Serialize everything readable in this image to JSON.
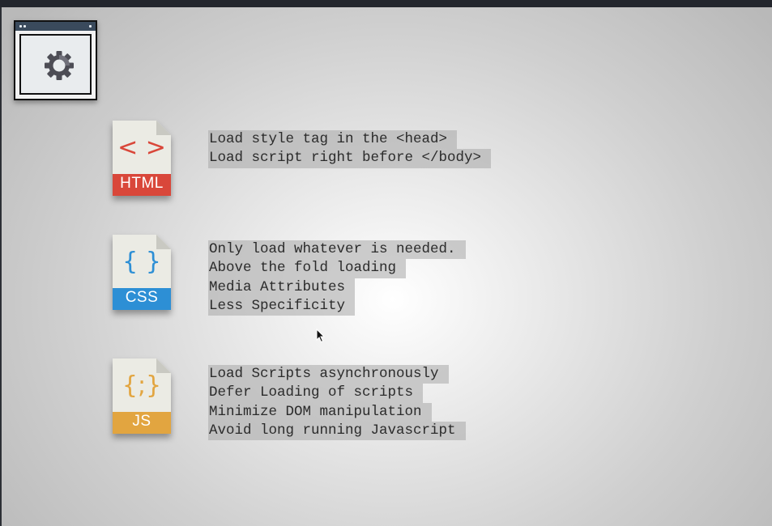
{
  "slide": {
    "html": {
      "glyph": "< >",
      "label": "HTML",
      "color": "#d9473a",
      "lines": [
        "Load style tag in the <head>",
        "Load script right before </body>"
      ]
    },
    "css": {
      "glyph": "{ }",
      "label": "CSS",
      "color": "#2d8fd5",
      "lines": [
        "Only load whatever is needed.",
        "Above the fold loading",
        "Media Attributes",
        "Less Specificity"
      ]
    },
    "js": {
      "glyph": "{;}",
      "label": "JS",
      "color": "#e2a540",
      "lines": [
        "Load Scripts asynchronously",
        "Defer Loading of scripts",
        "Minimize DOM manipulation",
        "Avoid long running Javascript"
      ]
    }
  },
  "icons": {
    "settings_window": "gear-window-icon",
    "cursor": "mouse-pointer-icon"
  },
  "colors": {
    "top_bar": "#23262d",
    "page_file": "#ebebe4",
    "text_highlight": "#a8a8a8"
  }
}
